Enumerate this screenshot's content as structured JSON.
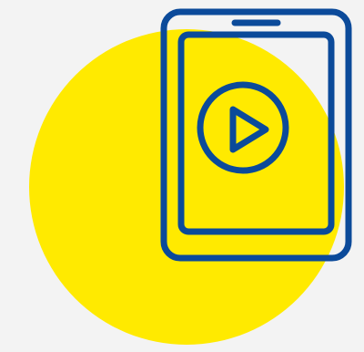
{
  "illustration": {
    "icon": "tablet-video-play-icon",
    "background_color": "#f3f3f3",
    "circle_color": "#ffea00",
    "outline_color": "#0b4a9a"
  }
}
